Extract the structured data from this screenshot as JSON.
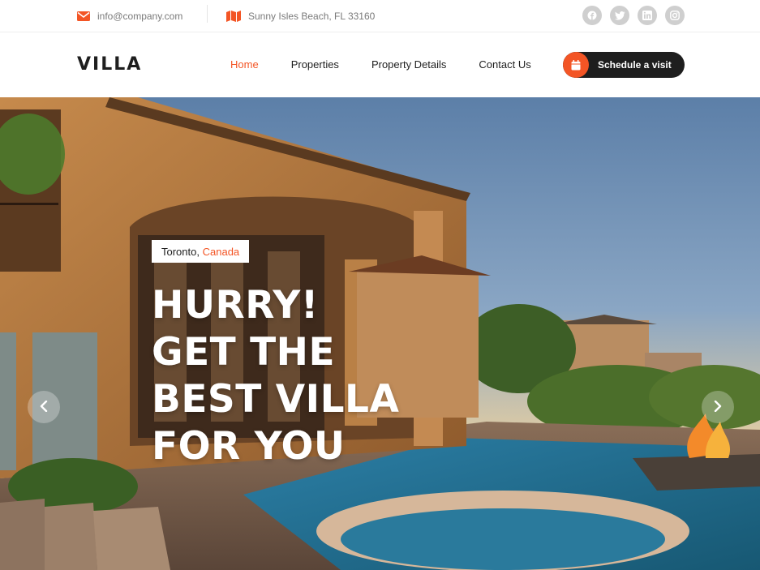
{
  "topbar": {
    "email": "info@company.com",
    "address": "Sunny Isles Beach, FL 33160",
    "socials": [
      "facebook-icon",
      "twitter-icon",
      "linkedin-icon",
      "instagram-icon"
    ]
  },
  "header": {
    "logo": "VILLA",
    "nav": [
      {
        "label": "Home",
        "active": true
      },
      {
        "label": "Properties",
        "active": false
      },
      {
        "label": "Property Details",
        "active": false
      },
      {
        "label": "Contact Us",
        "active": false
      }
    ],
    "schedule_label": "Schedule a visit"
  },
  "hero": {
    "city": "Toronto,",
    "country": "Canada",
    "headline": [
      "HURRY!",
      "GET THE",
      "BEST VILLA",
      "FOR YOU"
    ]
  },
  "icons": {
    "prev": "chevron-left-icon",
    "next": "chevron-right-icon"
  },
  "colors": {
    "accent": "#f35525",
    "dark": "#1e1e1e",
    "muted": "#7a7a7a"
  }
}
